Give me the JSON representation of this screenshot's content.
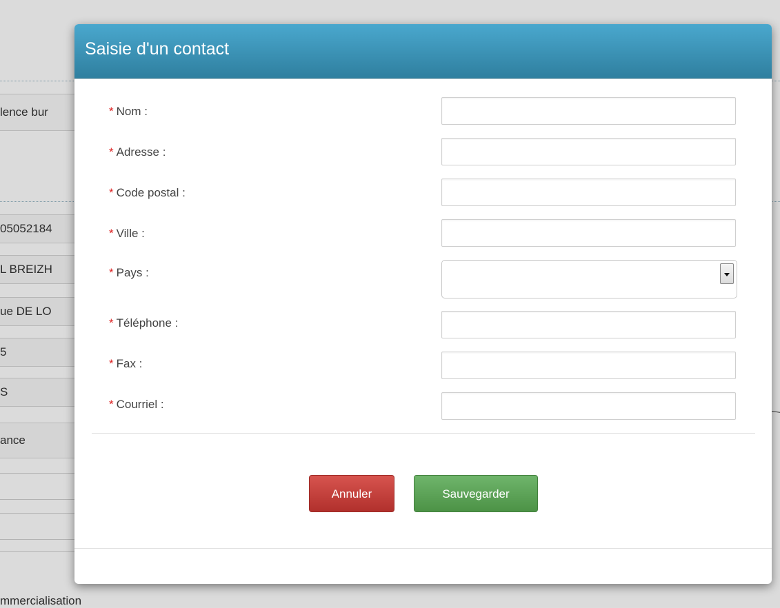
{
  "background": {
    "cells": [
      "lence bur",
      "05052184",
      "L BREIZH",
      "ue DE LO",
      "5",
      "S",
      "ance"
    ],
    "footer_text": "mmercialisation"
  },
  "modal": {
    "title": "Saisie d'un contact",
    "required_marker": "*",
    "fields": [
      {
        "label": "Nom :",
        "value": ""
      },
      {
        "label": "Adresse :",
        "value": ""
      },
      {
        "label": "Code postal :",
        "value": ""
      },
      {
        "label": "Ville :",
        "value": ""
      },
      {
        "label": "Pays :",
        "value": "",
        "type": "select"
      },
      {
        "label": "Téléphone :",
        "value": ""
      },
      {
        "label": "Fax :",
        "value": ""
      },
      {
        "label": "Courriel :",
        "value": ""
      }
    ],
    "buttons": {
      "cancel_label": "Annuler",
      "save_label": "Sauvegarder"
    }
  },
  "colors": {
    "header": "#3b94ba",
    "cancel": "#c0413c",
    "save": "#5da257",
    "required": "#dd2222"
  }
}
